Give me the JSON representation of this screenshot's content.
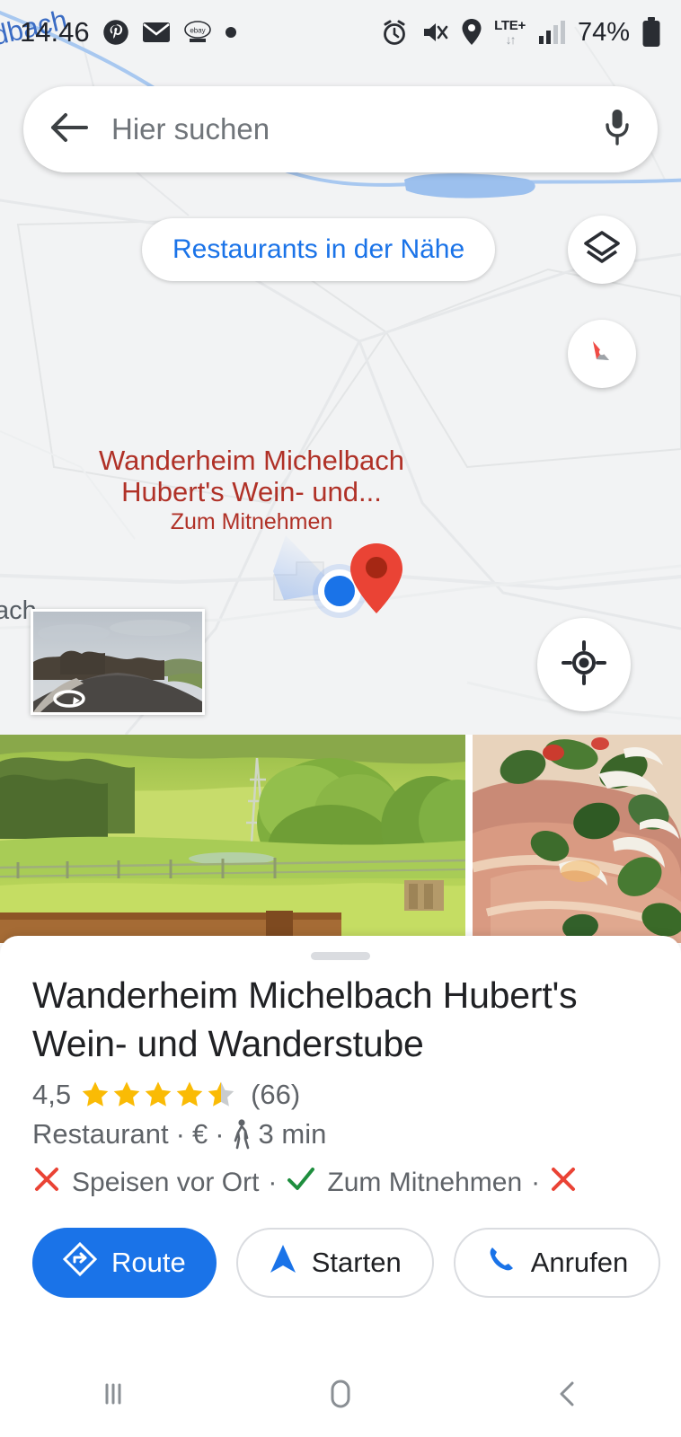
{
  "statusbar": {
    "time": "14.46",
    "battery": "74%",
    "network_label": "LTE+",
    "icons_left": [
      "pinterest-icon",
      "email-icon",
      "ebay-icon",
      "dot-icon"
    ],
    "icons_right": [
      "alarm-icon",
      "mute-icon",
      "location-icon",
      "signal-icon",
      "battery-icon"
    ]
  },
  "search": {
    "placeholder": "Hier suchen",
    "back_icon": "back-arrow-icon",
    "mic_icon": "microphone-icon"
  },
  "chips": {
    "nearby_restaurants": "Restaurants in der Nähe"
  },
  "map": {
    "label_line1": "Wanderheim Michelbach",
    "label_line2": "Hubert's Wein-  und...",
    "label_line3": "Zum Mitnehmen",
    "edge_label_left": "ach",
    "river_label": "ldbach",
    "marker_color": "#ea4335",
    "user_dot_color": "#1a73e8",
    "layers_icon": "layers-icon",
    "compass_icon": "compass-icon",
    "locate_icon": "my-location-icon",
    "streetview_thumb": "streetview-thumbnail"
  },
  "photos": [
    {
      "name": "landscape-meadow-photo"
    },
    {
      "name": "food-closeup-photo"
    }
  ],
  "place": {
    "title": "Wanderheim Michelbach Hubert's Wein- und Wanderstube",
    "rating": "4,5",
    "stars_filled": 4,
    "stars_half": 1,
    "stars_total": 5,
    "review_count": "(66)",
    "category": "Restaurant",
    "price": "€",
    "walk_icon": "walking-icon",
    "walk_time": "3 min",
    "separator": "·",
    "attributes": [
      {
        "icon": "cross-icon",
        "label": "Speisen vor Ort",
        "state": "no"
      },
      {
        "icon": "check-icon",
        "label": "Zum Mitnehmen",
        "state": "yes"
      },
      {
        "icon": "cross-icon",
        "label": "",
        "state": "no"
      }
    ]
  },
  "actions": {
    "route": "Route",
    "start": "Starten",
    "call": "Anrufen"
  },
  "navbar": {
    "recents": "recents-icon",
    "home": "home-icon",
    "back": "back-icon"
  },
  "colors": {
    "accent": "#1a73e8",
    "marker": "#ea4335",
    "star": "#fabb05",
    "label_red": "#b03127",
    "check_green": "#1e8e3e",
    "cross_red": "#ea4335"
  }
}
